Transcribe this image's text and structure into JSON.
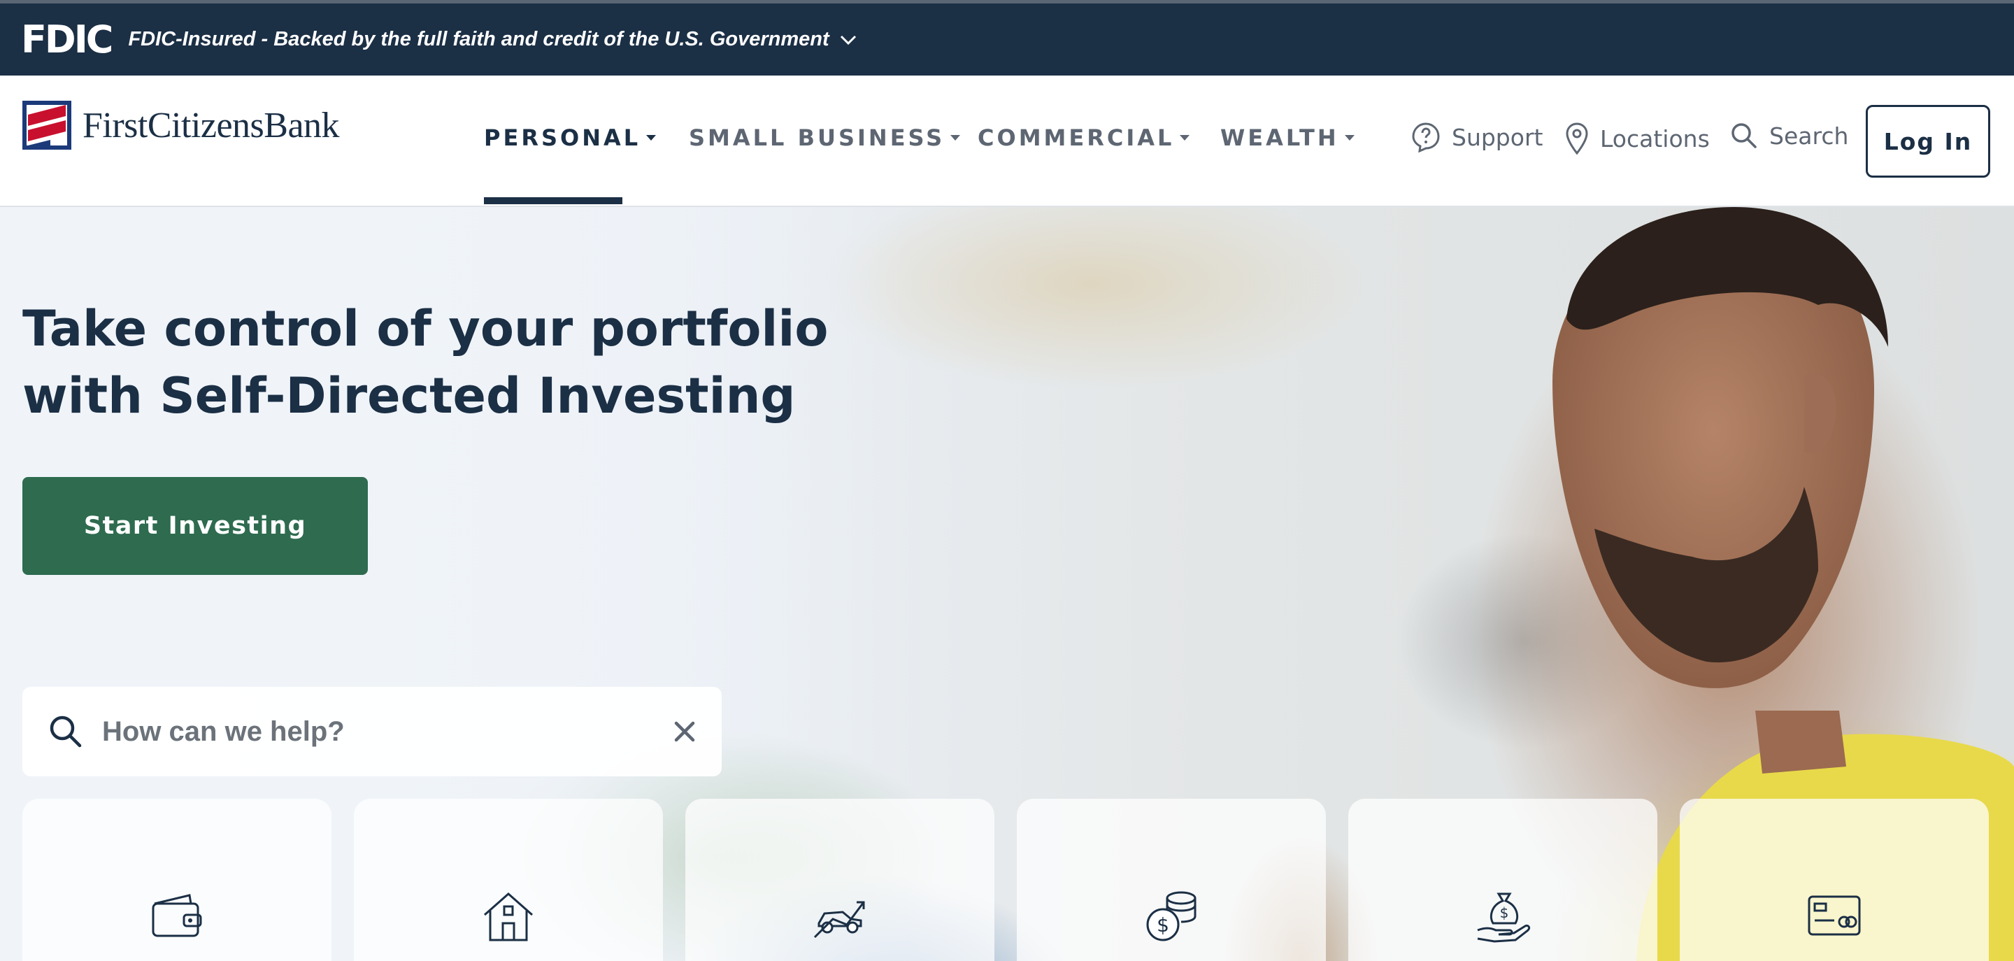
{
  "fdic": {
    "logo": "FDIC",
    "text": "FDIC-Insured - Backed by the full faith and credit of the U.S. Government"
  },
  "header": {
    "brand": "FirstCitizensBank",
    "nav": [
      {
        "label": "PERSONAL",
        "active": true
      },
      {
        "label": "SMALL BUSINESS",
        "active": false
      },
      {
        "label": "COMMERCIAL",
        "active": false
      },
      {
        "label": "WEALTH",
        "active": false
      }
    ],
    "utilities": {
      "support": "Support",
      "locations": "Locations",
      "search": "Search"
    },
    "login": "Log In"
  },
  "hero": {
    "headline_line1": "Take control of your portfolio",
    "headline_line2": "with Self-Directed Investing",
    "cta": "Start Investing",
    "search_placeholder": "How can we help?"
  },
  "tiles": [
    {
      "icon": "wallet-icon"
    },
    {
      "icon": "house-icon"
    },
    {
      "icon": "car-icon"
    },
    {
      "icon": "coins-icon"
    },
    {
      "icon": "money-bag-hand-icon"
    },
    {
      "icon": "credit-card-icon"
    }
  ],
  "colors": {
    "navy": "#1b2f45",
    "green": "#2e6b4f",
    "nav_gray": "#5d6672"
  }
}
